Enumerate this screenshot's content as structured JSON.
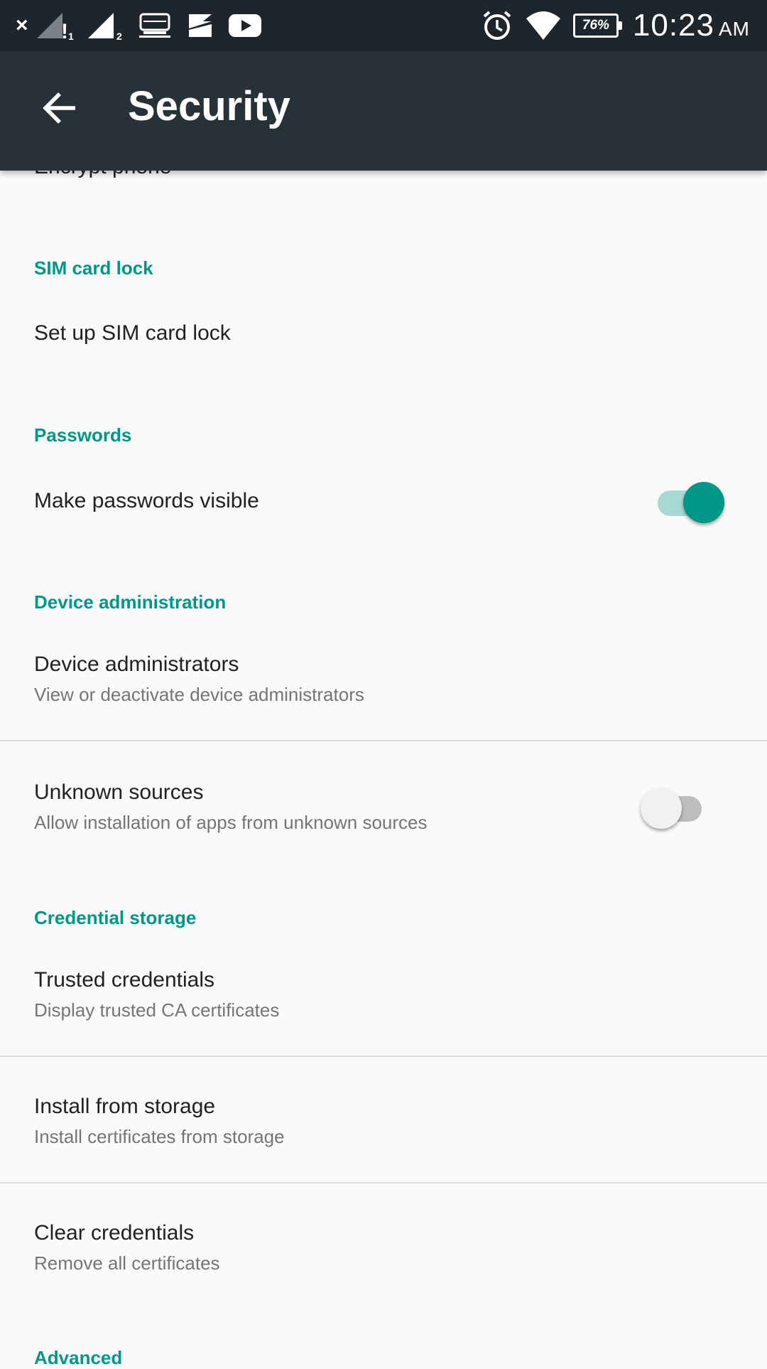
{
  "status_bar": {
    "close_glyph": "×",
    "sim1_label": "!",
    "sim1_sub": "1",
    "sim2_sub": "2",
    "battery": "76%",
    "time": "10:23",
    "ampm": "AM"
  },
  "app_bar": {
    "title": "Security",
    "background": "#263238"
  },
  "accent_color": "#009688",
  "partial_item": {
    "title": "Encrypt phone"
  },
  "sections": {
    "sim": {
      "header": "SIM card lock",
      "items": [
        {
          "title": "Set up SIM card lock"
        }
      ]
    },
    "passwords": {
      "header": "Passwords",
      "items": [
        {
          "title": "Make passwords visible",
          "toggle": true
        }
      ]
    },
    "device_admin": {
      "header": "Device administration",
      "items": [
        {
          "title": "Device administrators",
          "subtitle": "View or deactivate device administrators"
        },
        {
          "title": "Unknown sources",
          "subtitle": "Allow installation of apps from unknown sources",
          "toggle": false
        }
      ]
    },
    "credentials": {
      "header": "Credential storage",
      "items": [
        {
          "title": "Trusted credentials",
          "subtitle": "Display trusted CA certificates"
        },
        {
          "title": "Install from storage",
          "subtitle": "Install certificates from storage"
        },
        {
          "title": "Clear credentials",
          "subtitle": "Remove all certificates"
        }
      ]
    },
    "advanced": {
      "header": "Advanced"
    }
  }
}
